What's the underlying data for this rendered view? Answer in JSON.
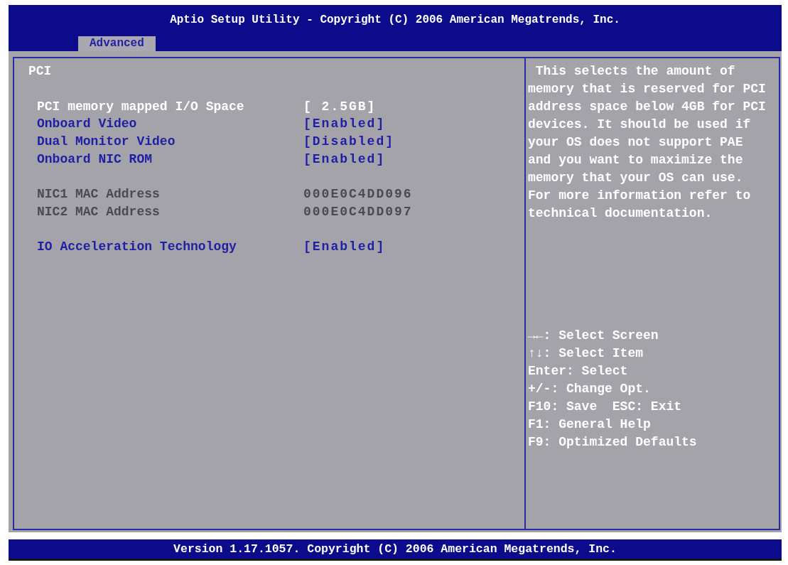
{
  "header": {
    "title": "Aptio Setup Utility - Copyright (C) 2006 American Megatrends, Inc."
  },
  "tabs": [
    {
      "label": "Advanced",
      "selected": true
    }
  ],
  "settings": {
    "heading": "PCI",
    "groups": [
      {
        "items": [
          {
            "kind": "option",
            "label": "PCI memory mapped I/O Space",
            "value": "[ 2.5GB]",
            "selected": true
          },
          {
            "kind": "option",
            "label": "Onboard Video",
            "value": "[Enabled]",
            "selected": false
          },
          {
            "kind": "option",
            "label": "Dual Monitor Video",
            "value": "[Disabled]",
            "selected": false
          },
          {
            "kind": "option",
            "label": "Onboard NIC ROM",
            "value": "[Enabled]",
            "selected": false
          }
        ]
      },
      {
        "items": [
          {
            "kind": "info",
            "label": "NIC1 MAC Address",
            "value": "000E0C4DD096",
            "selected": false
          },
          {
            "kind": "info",
            "label": "NIC2 MAC Address",
            "value": "000E0C4DD097",
            "selected": false
          }
        ]
      },
      {
        "items": [
          {
            "kind": "option",
            "label": "IO Acceleration Technology",
            "value": "[Enabled]",
            "selected": false
          }
        ]
      }
    ]
  },
  "help": {
    "description": "This selects the amount of memory that is reserved for PCI address space below 4GB for PCI devices. It should be used if your OS does not support PAE and you want to maximize the memory that your OS can use. For more information refer to technical documentation.",
    "keys": [
      "→←: Select Screen",
      "↑↓: Select Item",
      "Enter: Select",
      "+/-: Change Opt.",
      "F10: Save  ESC: Exit",
      "F1: General Help",
      "F9: Optimized Defaults"
    ]
  },
  "footer": {
    "text": "Version 1.17.1057. Copyright (C) 2006 American Megatrends, Inc."
  }
}
